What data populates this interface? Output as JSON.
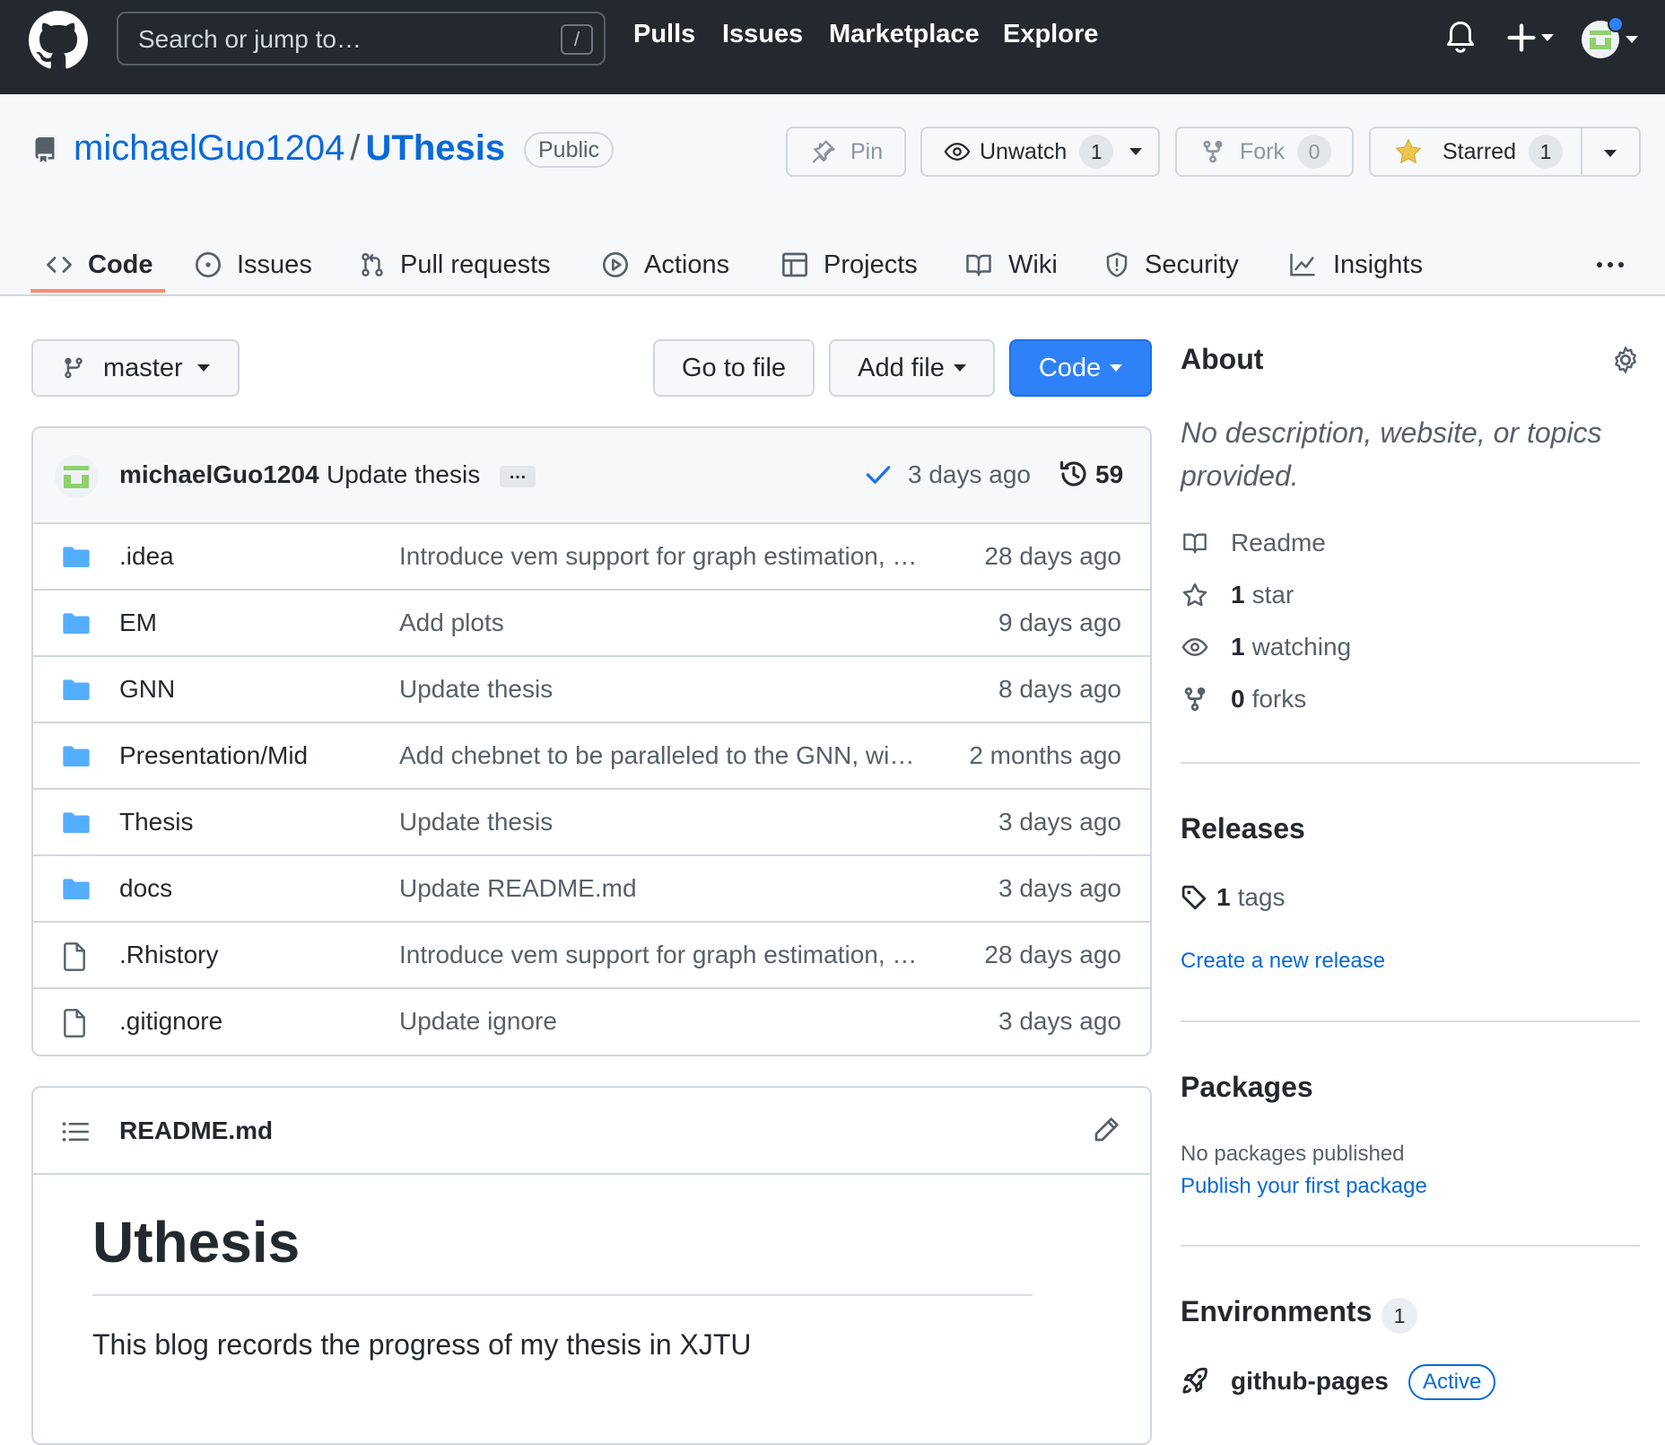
{
  "topbar": {
    "search_placeholder": "Search or jump to…",
    "slash_key": "/",
    "nav": [
      "Pulls",
      "Issues",
      "Marketplace",
      "Explore"
    ]
  },
  "repo": {
    "owner": "michaelGuo1204",
    "separator": "/",
    "name": "UThesis",
    "visibility": "Public",
    "pin_label": "Pin",
    "watch_label": "Unwatch",
    "watch_count": "1",
    "fork_label": "Fork",
    "fork_count": "0",
    "star_label": "Starred",
    "star_count": "1"
  },
  "tabs": [
    {
      "label": "Code",
      "icon": "code-icon"
    },
    {
      "label": "Issues",
      "icon": "issue-icon"
    },
    {
      "label": "Pull requests",
      "icon": "pull-request-icon"
    },
    {
      "label": "Actions",
      "icon": "play-icon"
    },
    {
      "label": "Projects",
      "icon": "table-icon"
    },
    {
      "label": "Wiki",
      "icon": "book-icon"
    },
    {
      "label": "Security",
      "icon": "shield-icon"
    },
    {
      "label": "Insights",
      "icon": "graph-icon"
    }
  ],
  "toolbar": {
    "branch": "master",
    "goto_file": "Go to file",
    "add_file": "Add file",
    "code": "Code"
  },
  "latest_commit": {
    "author": "michaelGuo1204",
    "message": "Update thesis",
    "ellipsis": "…",
    "time": "3 days ago",
    "commit_count": "59"
  },
  "files": [
    {
      "type": "dir",
      "name": ".idea",
      "message": "Introduce vem support for graph estimation, sta…",
      "date": "28 days ago"
    },
    {
      "type": "dir",
      "name": "EM",
      "message": "Add plots",
      "date": "9 days ago"
    },
    {
      "type": "dir",
      "name": "GNN",
      "message": "Update thesis",
      "date": "8 days ago"
    },
    {
      "type": "dir",
      "name": "Presentation/Mid",
      "message": "Add chebnet to be paralleled to the GNN, with…",
      "date": "2 months ago"
    },
    {
      "type": "dir",
      "name": "Thesis",
      "message": "Update thesis",
      "date": "3 days ago"
    },
    {
      "type": "dir",
      "name": "docs",
      "message": "Update README.md",
      "date": "3 days ago"
    },
    {
      "type": "file",
      "name": ".Rhistory",
      "message": "Introduce vem support for graph estimation, sta…",
      "date": "28 days ago"
    },
    {
      "type": "file",
      "name": ".gitignore",
      "message": "Update ignore",
      "date": "3 days ago"
    }
  ],
  "readme": {
    "filename": "README.md",
    "heading": "Uthesis",
    "body": "This blog records the progress of my thesis in XJTU"
  },
  "sidebar": {
    "about_title": "About",
    "about_desc": "No description, website, or topics provided.",
    "readme_label": "Readme",
    "stars_count": "1",
    "stars_label": "star",
    "watching_count": "1",
    "watching_label": "watching",
    "forks_count": "0",
    "forks_label": "forks",
    "releases_title": "Releases",
    "tags_count": "1",
    "tags_label": "tags",
    "create_release": "Create a new release",
    "packages_title": "Packages",
    "no_packages": "No packages published",
    "publish_package": "Publish your first package",
    "environments_title": "Environments",
    "environments_count": "1",
    "environment_name": "github-pages",
    "environment_status": "Active"
  },
  "colors": {
    "header_bg": "#24292f",
    "link": "#0969da",
    "primary_button": "#2f81f7",
    "folder": "#54aeff",
    "star": "#eac54f",
    "tab_underline": "#fd8c73"
  }
}
